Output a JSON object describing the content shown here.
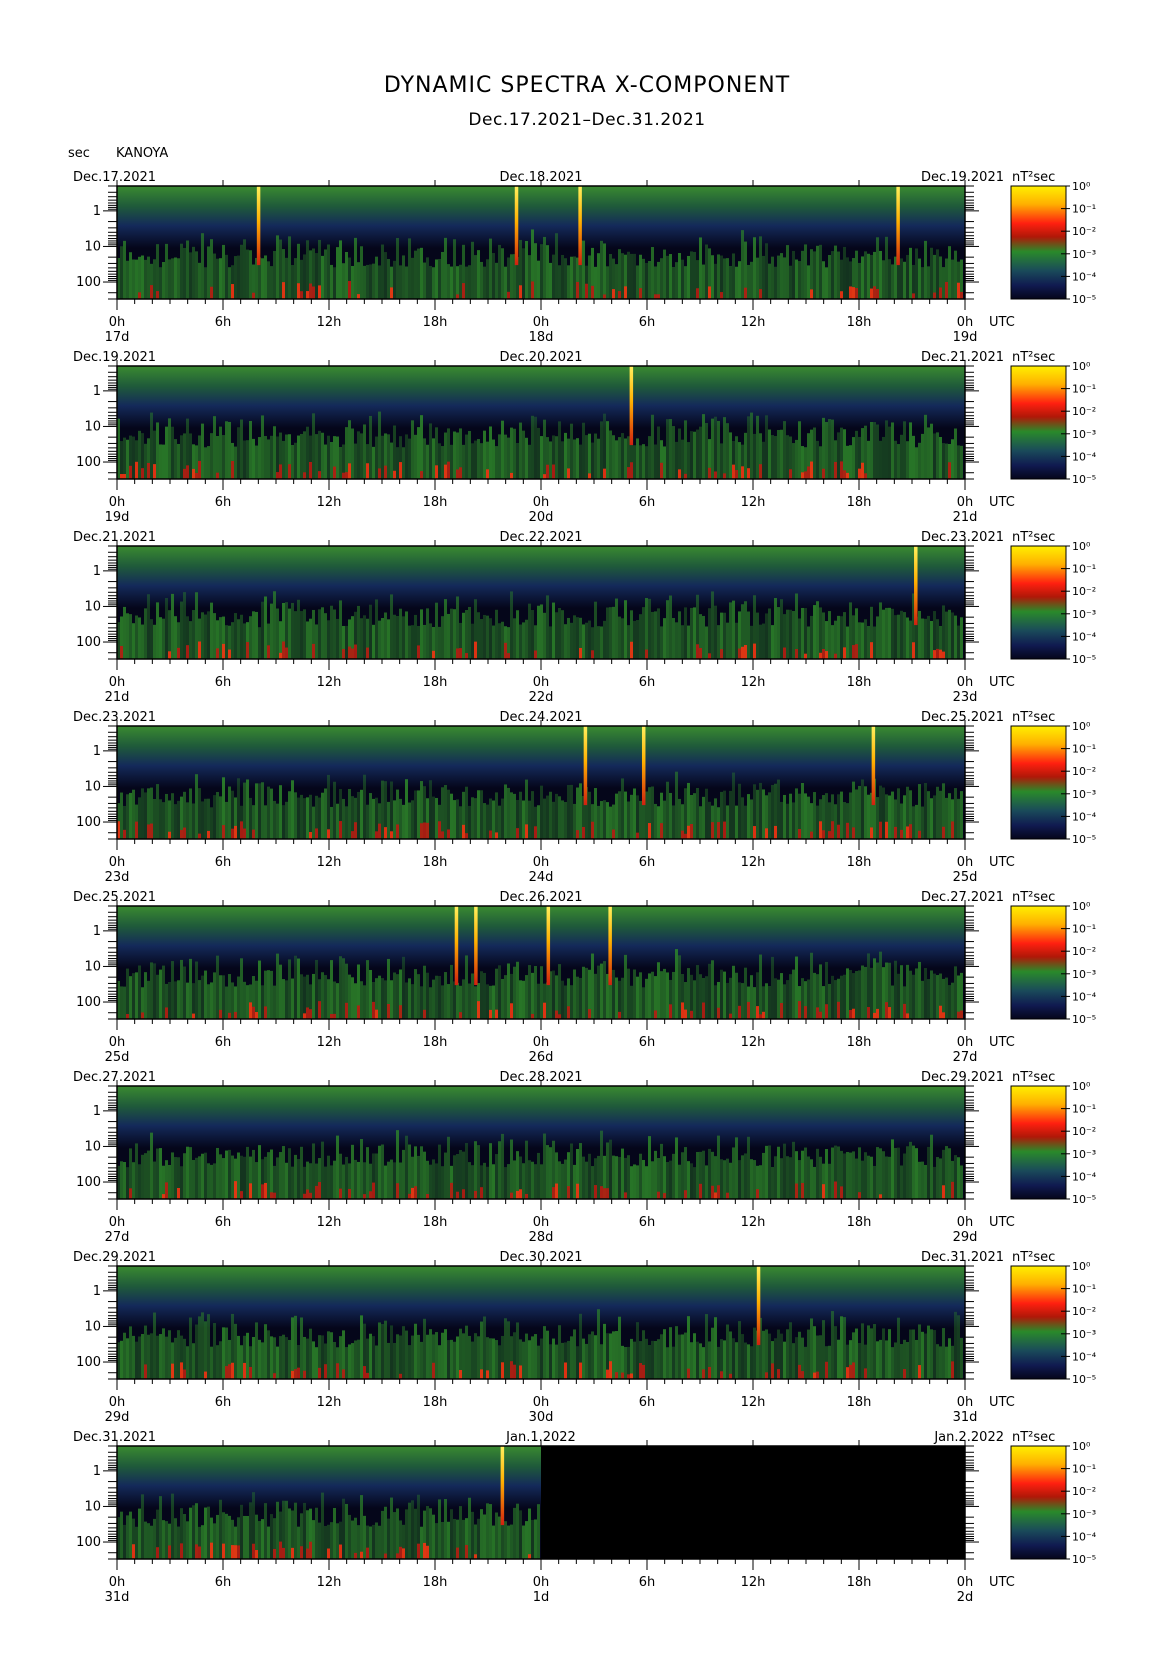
{
  "title": "DYNAMIC SPECTRA X-COMPONENT",
  "subtitle": "Dec.17.2021–Dec.31.2021",
  "y_unit": "sec",
  "station": "KANOYA",
  "colorbar_unit": "nT²sec",
  "colors": {
    "low": "#0a0a28",
    "mid_low": "#1a3a7a",
    "mid": "#2e8b2e",
    "high": "#e02010",
    "top": "#ffe800"
  },
  "chart_data": {
    "type": "heatmap",
    "y_axis": {
      "label": "sec",
      "scale": "log",
      "ticks": [
        "1",
        "10",
        "100"
      ],
      "range": [
        0.2,
        300
      ]
    },
    "colorbar": {
      "unit": "nT²sec",
      "scale": "log",
      "ticks": [
        "10⁰",
        "10⁻¹",
        "10⁻²",
        "10⁻³",
        "10⁻⁴",
        "10⁻⁵"
      ]
    },
    "x_tick_labels": [
      "0h",
      "6h",
      "12h",
      "18h",
      "0h",
      "6h",
      "12h",
      "18h",
      "0h"
    ],
    "x_unit_label": "UTC",
    "panels": [
      {
        "start_date": "Dec.17.2021",
        "mid_date": "Dec.18.2021",
        "end_date": "Dec.19.2021",
        "day_start": "17d",
        "day_mid": "18d",
        "day_end": "19d",
        "spikes_hours": [
          8,
          22.6,
          26.2,
          44.2
        ],
        "data_end_hours": 48
      },
      {
        "start_date": "Dec.19.2021",
        "mid_date": "Dec.20.2021",
        "end_date": "Dec.21.2021",
        "day_start": "19d",
        "day_mid": "20d",
        "day_end": "21d",
        "spikes_hours": [
          29.1
        ],
        "data_end_hours": 48
      },
      {
        "start_date": "Dec.21.2021",
        "mid_date": "Dec.22.2021",
        "end_date": "Dec.23.2021",
        "day_start": "21d",
        "day_mid": "22d",
        "day_end": "23d",
        "spikes_hours": [
          45.2
        ],
        "data_end_hours": 48
      },
      {
        "start_date": "Dec.23.2021",
        "mid_date": "Dec.24.2021",
        "end_date": "Dec.25.2021",
        "day_start": "23d",
        "day_mid": "24d",
        "day_end": "25d",
        "spikes_hours": [
          26.5,
          29.8,
          42.8
        ],
        "data_end_hours": 48
      },
      {
        "start_date": "Dec.25.2021",
        "mid_date": "Dec.26.2021",
        "end_date": "Dec.27.2021",
        "day_start": "25d",
        "day_mid": "26d",
        "day_end": "27d",
        "spikes_hours": [
          19.2,
          20.3,
          24.4,
          27.9
        ],
        "data_end_hours": 48
      },
      {
        "start_date": "Dec.27.2021",
        "mid_date": "Dec.28.2021",
        "end_date": "Dec.29.2021",
        "day_start": "27d",
        "day_mid": "28d",
        "day_end": "29d",
        "spikes_hours": [],
        "data_end_hours": 48
      },
      {
        "start_date": "Dec.29.2021",
        "mid_date": "Dec.30.2021",
        "end_date": "Dec.31.2021",
        "day_start": "29d",
        "day_mid": "30d",
        "day_end": "31d",
        "spikes_hours": [
          36.3
        ],
        "data_end_hours": 48
      },
      {
        "start_date": "Dec.31.2021",
        "mid_date": "Jan.1.2022",
        "end_date": "Jan.2.2022",
        "day_start": "31d",
        "day_mid": "1d",
        "day_end": "2d",
        "spikes_hours": [
          21.8
        ],
        "data_end_hours": 24
      }
    ]
  }
}
